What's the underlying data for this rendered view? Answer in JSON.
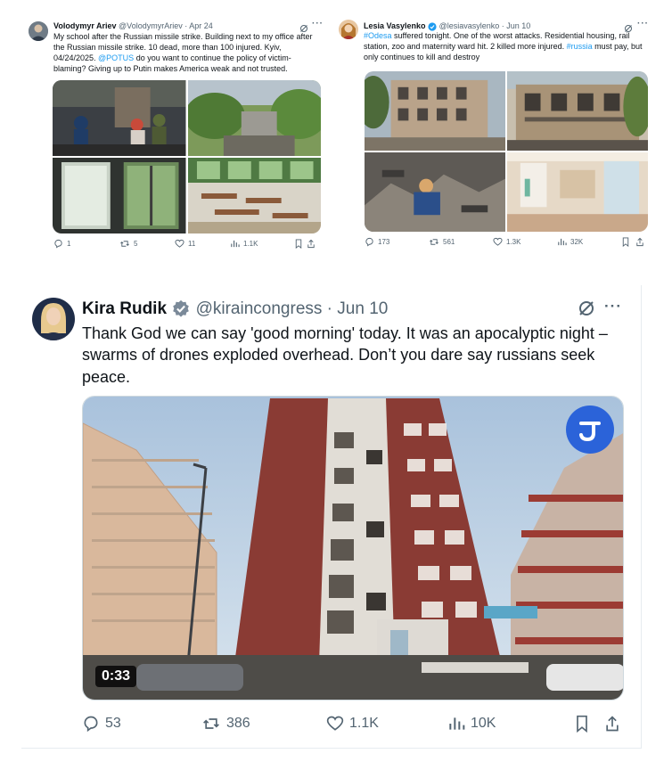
{
  "tweets": [
    {
      "author": "Volodymyr Ariev",
      "handle": "@VolodymyrAriev",
      "separator": "·",
      "date": "Apr 24",
      "text_part1": "My school after the Russian missile strike. Building next to my office after the Russian missile strike. 10 dead, more than 100 injured. Kyiv, 04/24/2025. ",
      "mention": "@POTUS",
      "text_part2": " do you want to continue the policy of victim-blaming? Giving up to Putin makes America weak and not trusted.",
      "replies": "1",
      "reposts": "5",
      "likes": "11",
      "views": "1.1K"
    },
    {
      "author": "Lesia Vasylenko",
      "handle": "@lesiavasylenko",
      "separator": "·",
      "date": "Jun 10",
      "hashtag1": "#Odesa",
      "text_part1": " suffered tonight. One of the worst attacks. Residential housing, rail station, zoo and maternity ward hit. 2 killed more injured. ",
      "hashtag2": "#russia",
      "text_part2": " must pay, but only continues to kill and destroy",
      "replies": "173",
      "reposts": "561",
      "likes": "1.3K",
      "views": "32K"
    },
    {
      "author": "Kira Rudik",
      "handle": "@kiraincongress",
      "separator": "·",
      "date": "Jun 10",
      "text": "Thank God we can say 'good morning' today. It was an apocalyptic night – swarms of drones exploded overhead. Don’t you dare say russians seek peace.",
      "video_duration": "0:33",
      "replies": "53",
      "reposts": "386",
      "likes": "1.1K",
      "views": "10K"
    }
  ],
  "more_label": "···",
  "colors": {
    "link": "#1d9bf0",
    "verified": "#1d9bf0",
    "muted": "#536471"
  }
}
